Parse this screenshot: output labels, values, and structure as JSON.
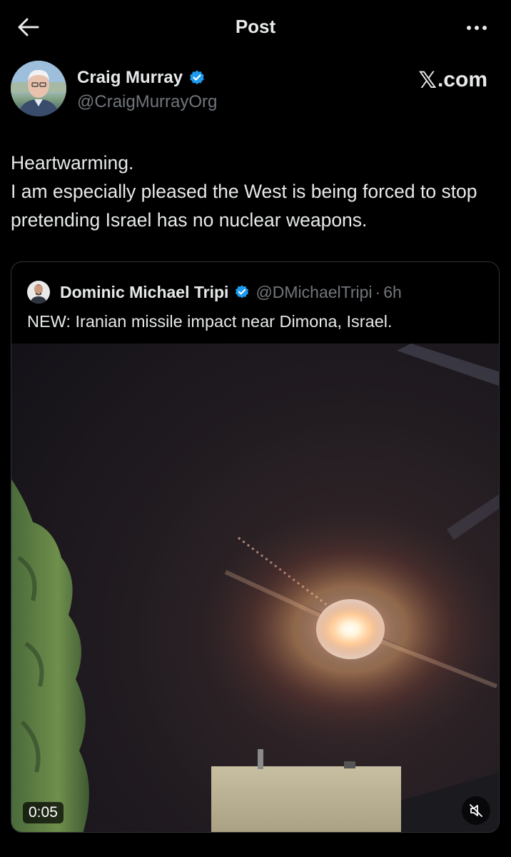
{
  "header": {
    "title": "Post",
    "back_icon": "arrow-left-icon",
    "more_icon": "more-horizontal-icon"
  },
  "author": {
    "name": "Craig Murray",
    "handle": "@CraigMurrayOrg",
    "verified": true,
    "site_logo_x": "𝕏",
    "site_logo_rest": ".com"
  },
  "post": {
    "text": "Heartwarming.\nI am especially pleased the West is being forced to stop pretending Israel has no nuclear weapons."
  },
  "quoted_post": {
    "name": "Dominic Michael Tripi",
    "handle": "@DMichaelTripi",
    "separator": "·",
    "time": "6h",
    "verified": true,
    "text": "NEW: Iranian missile impact near Dimona, Israel.",
    "video": {
      "duration": "0:05",
      "mute_icon": "speaker-muted-icon"
    }
  },
  "colors": {
    "background": "#000000",
    "text": "#e7e9ea",
    "secondary_text": "#71767b",
    "verified": "#1d9bf0",
    "border": "#2f3336"
  }
}
